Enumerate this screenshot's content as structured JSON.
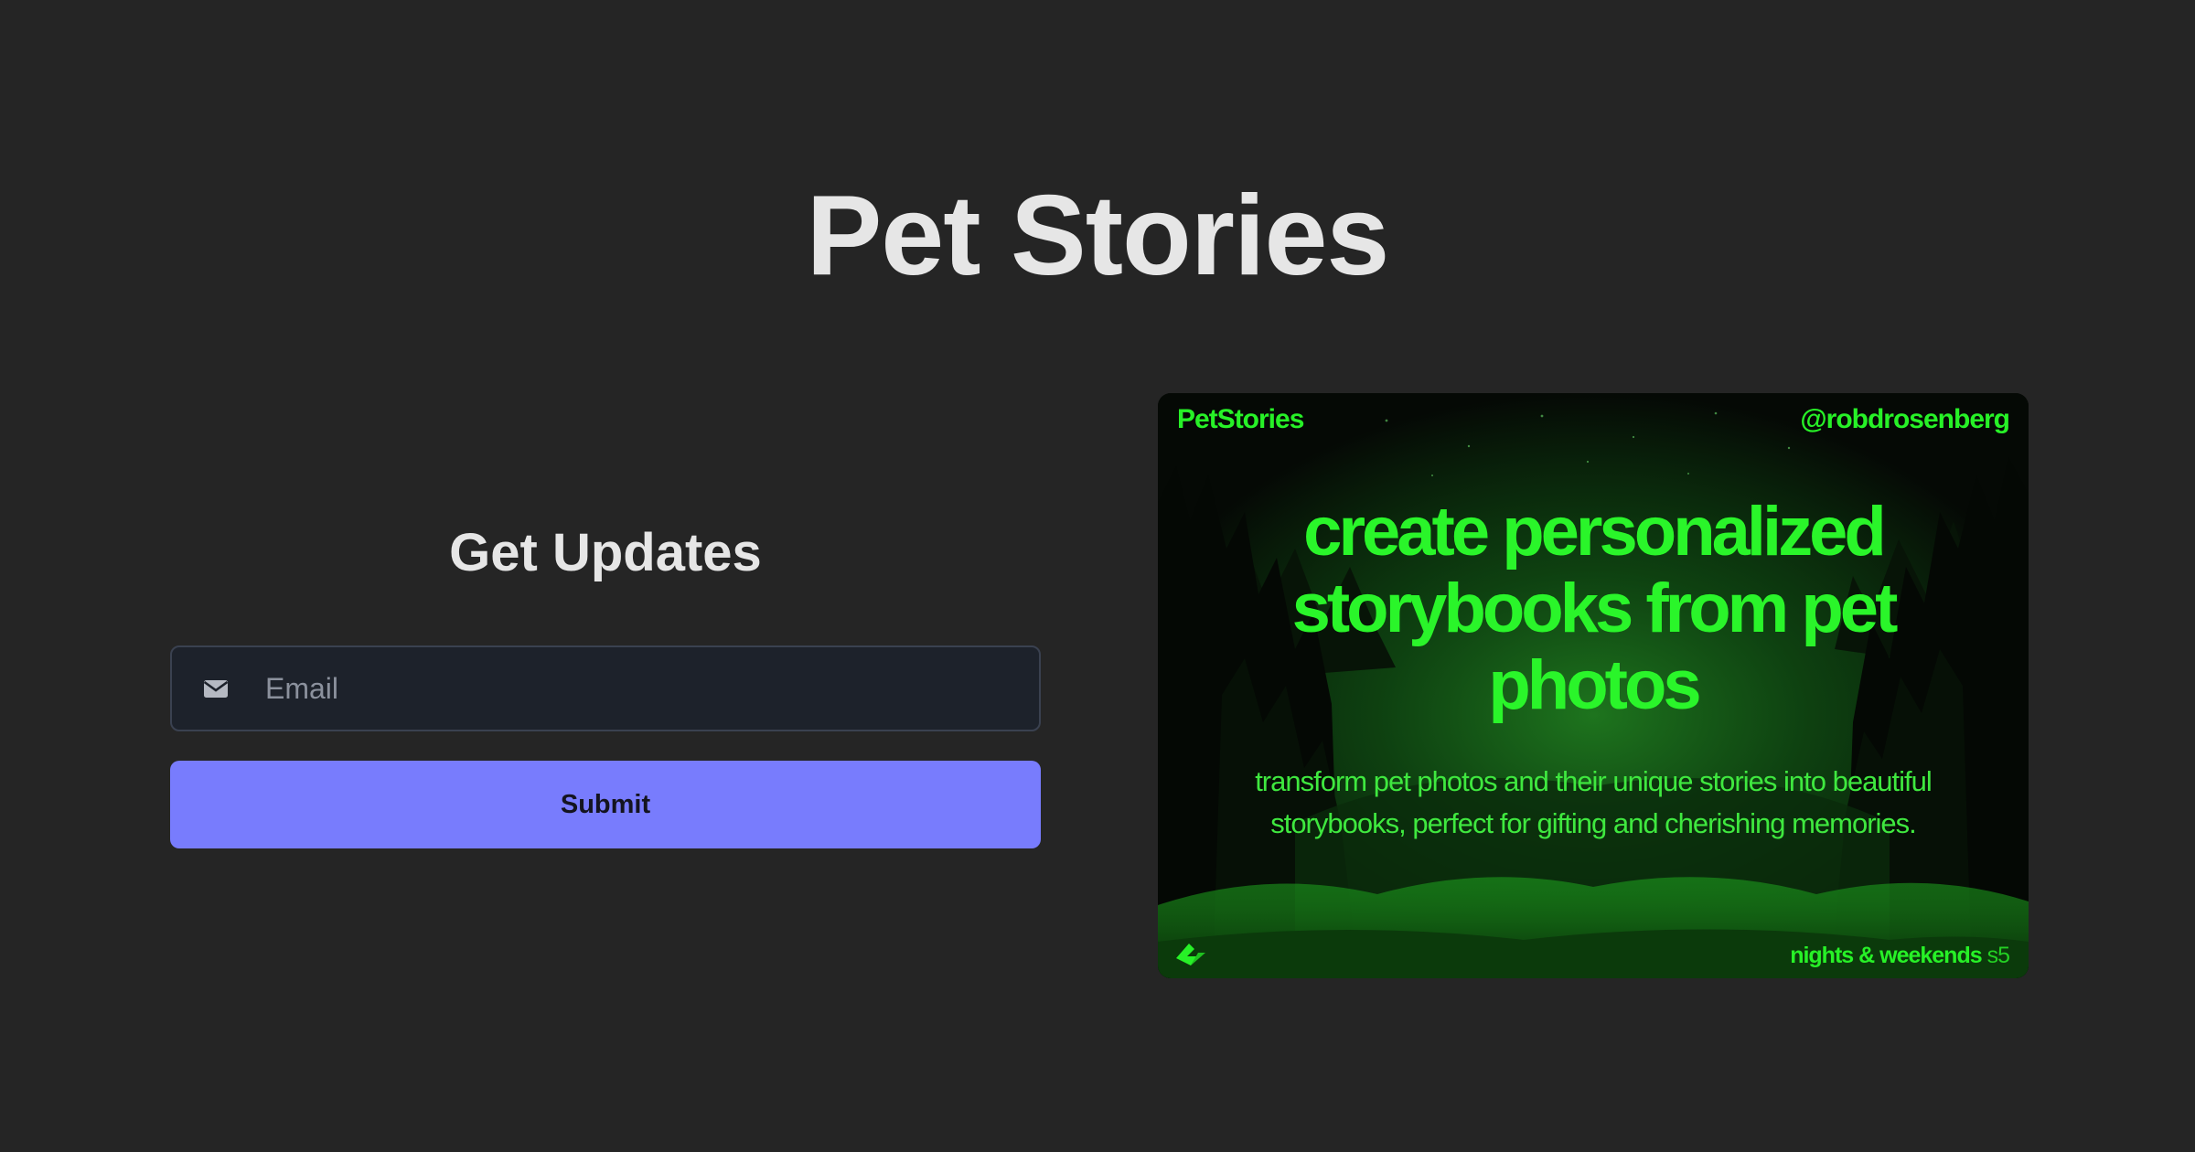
{
  "page": {
    "title": "Pet Stories"
  },
  "form": {
    "heading": "Get Updates",
    "email_placeholder": "Email",
    "email_value": "",
    "email_icon": "mail-icon",
    "submit_label": "Submit",
    "accent_color": "#787cfd"
  },
  "promo": {
    "brand": "PetStories",
    "handle": "@robdrosenberg",
    "headline": "create personalized storybooks from pet photos",
    "subtitle": "transform pet photos and their unique stories into beautiful storybooks, perfect for gifting and cherishing memories.",
    "footer_label": "nights & weekends",
    "footer_season": "s5",
    "logo_icon": "buildspace-logo-icon",
    "text_color": "#27f127",
    "background": "dark green forest silhouette"
  }
}
